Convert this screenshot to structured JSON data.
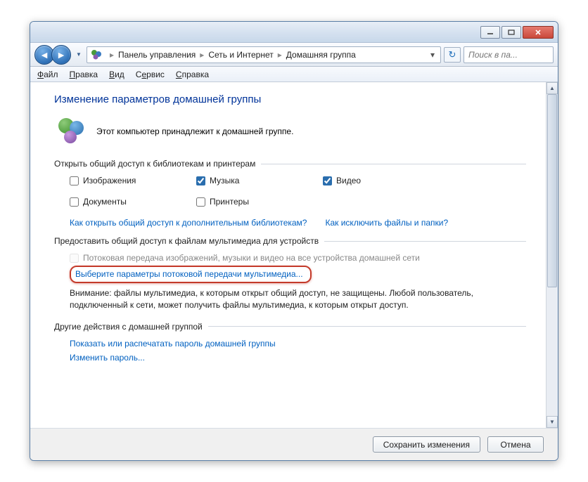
{
  "titlebar": {
    "minimize": "—",
    "maximize": "▭",
    "close": "✕"
  },
  "nav": {
    "breadcrumb": [
      "Панель управления",
      "Сеть и Интернет",
      "Домашняя группа"
    ],
    "search_placeholder": "Поиск в па..."
  },
  "menubar": {
    "file": "Файл",
    "edit": "Правка",
    "view": "Вид",
    "tools": "Сервис",
    "help": "Справка"
  },
  "page": {
    "title": "Изменение параметров домашней группы",
    "identity": "Этот компьютер принадлежит к домашней группе.",
    "section_libs": "Открыть общий доступ к библиотекам и принтерам",
    "checkboxes": {
      "images": {
        "label": "Изображения",
        "checked": false
      },
      "music": {
        "label": "Музыка",
        "checked": true
      },
      "video": {
        "label": "Видео",
        "checked": true
      },
      "documents": {
        "label": "Документы",
        "checked": false
      },
      "printers": {
        "label": "Принтеры",
        "checked": false
      }
    },
    "link_additional": "Как открыть общий доступ к дополнительным библиотекам?",
    "link_exclude": "Как исключить файлы и папки?",
    "section_media": "Предоставить общий доступ к файлам мультимедиа для устройств",
    "streaming_cb": "Потоковая передача изображений, музыки и видео на все устройства домашней сети",
    "streaming_link": "Выберите параметры потоковой передачи мультимедиа...",
    "warning": "Внимание: файлы мультимедиа, к которым открыт общий доступ, не защищены. Любой пользователь, подключенный к сети, может получить файлы мультимедиа, к которым открыт доступ.",
    "section_other": "Другие действия с домашней группой",
    "link_show_pw": "Показать или распечатать пароль домашней группы",
    "link_change_pw": "Изменить пароль..."
  },
  "footer": {
    "save": "Сохранить изменения",
    "cancel": "Отмена"
  }
}
